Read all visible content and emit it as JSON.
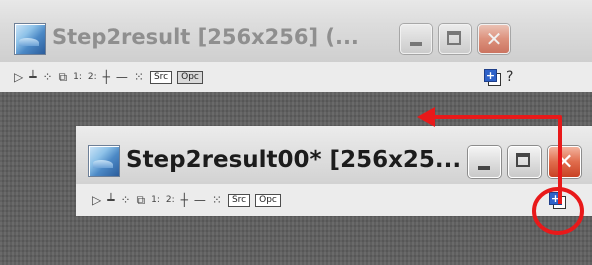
{
  "windows": {
    "back": {
      "title": "Step2result [256x256] (...",
      "toolbar": {
        "src_label": "Src",
        "opc_label": "Opc",
        "help_label": "?"
      }
    },
    "front": {
      "title": "Step2result00* [256x25...",
      "toolbar": {
        "src_label": "Src",
        "opc_label": "Opc"
      }
    }
  },
  "colors": {
    "arrow": "#e8191a",
    "highlight_circle": "#e8191a",
    "canvas": "#5f5f5f",
    "title_active": "#1c1c1c",
    "title_inactive": "#8f8f8f"
  },
  "icons": [
    "window-app-icon",
    "pointer-icon",
    "anchor-icon",
    "zoom-icon",
    "copy-icon",
    "channel-1-icon",
    "channel-2-icon",
    "crosshair-icon",
    "line-icon",
    "grid-icon",
    "float-window-icon",
    "minimize-icon",
    "maximize-icon",
    "close-icon"
  ]
}
